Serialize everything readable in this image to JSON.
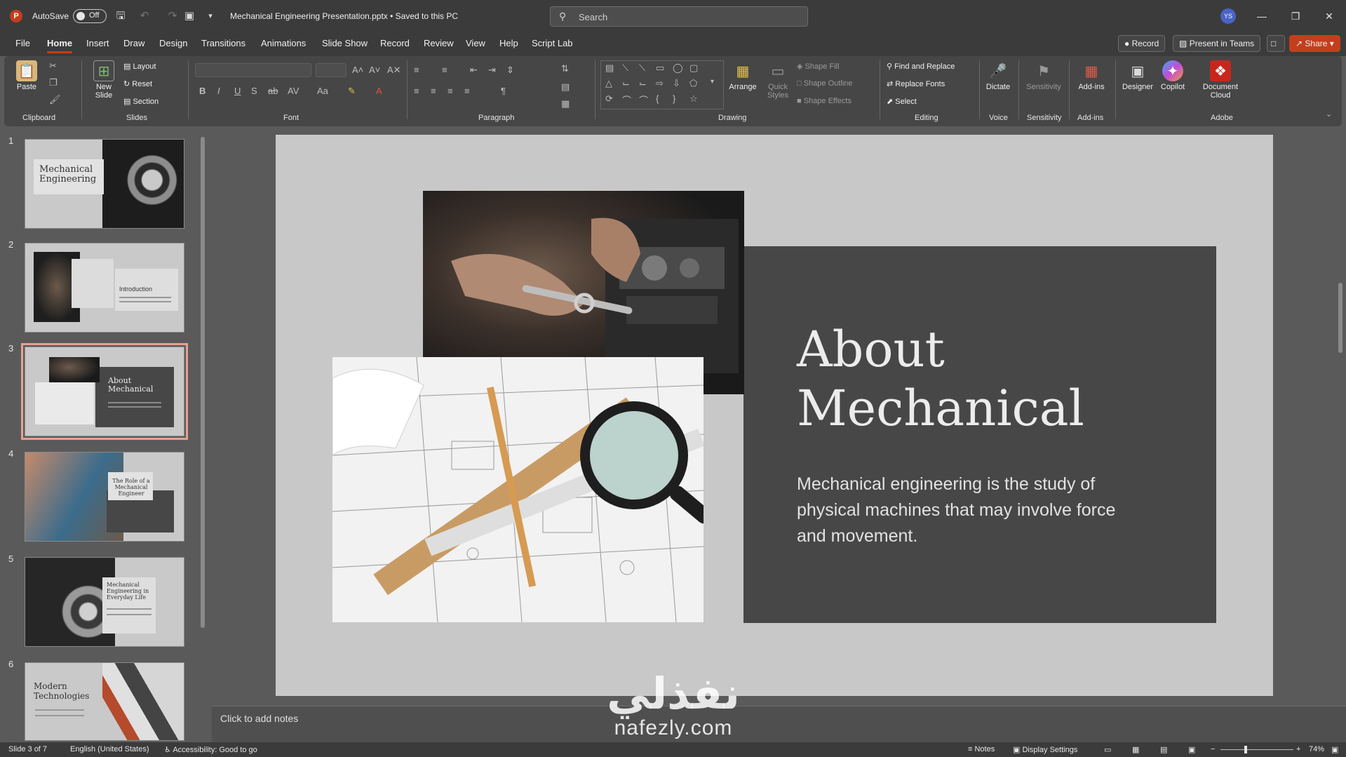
{
  "window": {
    "autosave_label": "AutoSave",
    "autosave_state": "Off",
    "document_title": "Mechanical Engineering Presentation.pptx • Saved to this PC",
    "search_placeholder": "Search",
    "user_initials": "YS"
  },
  "menu": {
    "tabs": [
      "File",
      "Home",
      "Insert",
      "Draw",
      "Design",
      "Transitions",
      "Animations",
      "Slide Show",
      "Record",
      "Review",
      "View",
      "Help",
      "Script Lab"
    ],
    "active_tab": "Home",
    "record_label": "Record",
    "present_teams_label": "Present in Teams",
    "share_label": "Share"
  },
  "ribbon": {
    "groups": {
      "clipboard": "Clipboard",
      "slides": "Slides",
      "font": "Font",
      "paragraph": "Paragraph",
      "drawing": "Drawing",
      "editing": "Editing",
      "voice": "Voice",
      "sensitivity": "Sensitivity",
      "addins": "Add-ins",
      "adobe": "Adobe"
    },
    "paste_label": "Paste",
    "new_slide_label": "New Slide",
    "layout_label": "Layout",
    "reset_label": "Reset",
    "section_label": "Section",
    "arrange_label": "Arrange",
    "quick_styles_label": "Quick Styles",
    "shape_fill_label": "Shape Fill",
    "shape_outline_label": "Shape Outline",
    "shape_effects_label": "Shape Effects",
    "find_replace_label": "Find and Replace",
    "replace_fonts_label": "Replace Fonts",
    "select_label": "Select",
    "dictate_label": "Dictate",
    "sensitivity_label": "Sensitivity",
    "addins_label": "Add-ins",
    "designer_label": "Designer",
    "copilot_label": "Copilot",
    "document_cloud_label": "Document Cloud"
  },
  "thumbnails": [
    {
      "num": "1",
      "title": "Mechanical Engineering"
    },
    {
      "num": "2",
      "title": "Introduction"
    },
    {
      "num": "3",
      "title": "About Mechanical"
    },
    {
      "num": "4",
      "title": "The Role of a Mechanical Engineer"
    },
    {
      "num": "5",
      "title": "Mechanical Engineering in Everyday Life"
    },
    {
      "num": "6",
      "title": "Modern Technologies"
    }
  ],
  "slide": {
    "title": "About Mechanical",
    "body": "Mechanical engineering is the study of physical machines that may involve force and movement."
  },
  "notes_placeholder": "Click to add notes",
  "status": {
    "slide_position": "Slide 3 of 7",
    "language": "English (United States)",
    "accessibility": "Accessibility: Good to go",
    "notes_label": "Notes",
    "display_settings_label": "Display Settings",
    "zoom": "74%"
  },
  "watermark": {
    "arabic": "نفذلي",
    "latin": "nafezly.com"
  },
  "colors": {
    "accent": "#c43e1c",
    "slide_background": "#c8c8c8",
    "slide_panel": "#474747"
  }
}
